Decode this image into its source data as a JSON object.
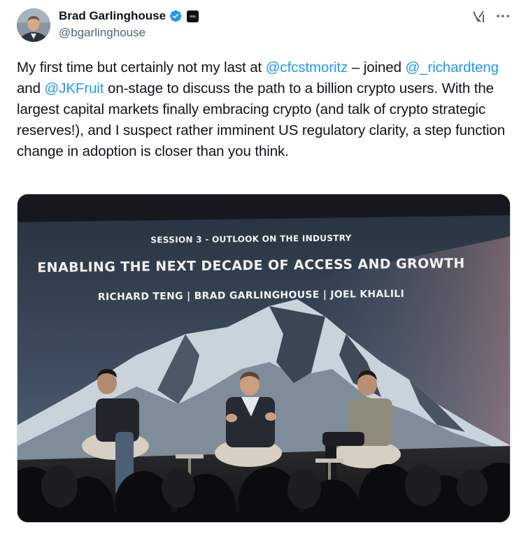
{
  "author": {
    "display_name": "Brad Garlinghouse",
    "handle": "@bgarlinghouse",
    "verified": true,
    "verified_color": "#1d9bf0",
    "avatar_icon": "profile-photo"
  },
  "actions": {
    "grok_icon": "grok-icon",
    "more_icon": "more-dots-icon"
  },
  "tweet": {
    "seg1": "My first time but certainly not my last at ",
    "mention1": "@cfcstmoritz",
    "seg2": " – joined ",
    "mention2": "@_richardteng",
    "seg3": " and ",
    "mention3": "@JKFruit",
    "seg4": " on-stage to discuss the path to a billion crypto users. With the largest capital markets finally embracing crypto (and talk of crypto strategic reserves!), and I suspect rather imminent US regulatory clarity, a step function change in adoption is closer than you think.",
    "link_color": "#1d9bf0"
  },
  "media": {
    "slide_session": "SESSION 3 - OUTLOOK ON THE INDUSTRY",
    "slide_title": "ENABLING THE NEXT DECADE OF ACCESS AND GROWTH",
    "slide_speakers": "RICHARD TENG  |  BRAD GARLINGHOUSE  |  JOEL KHALILI"
  }
}
